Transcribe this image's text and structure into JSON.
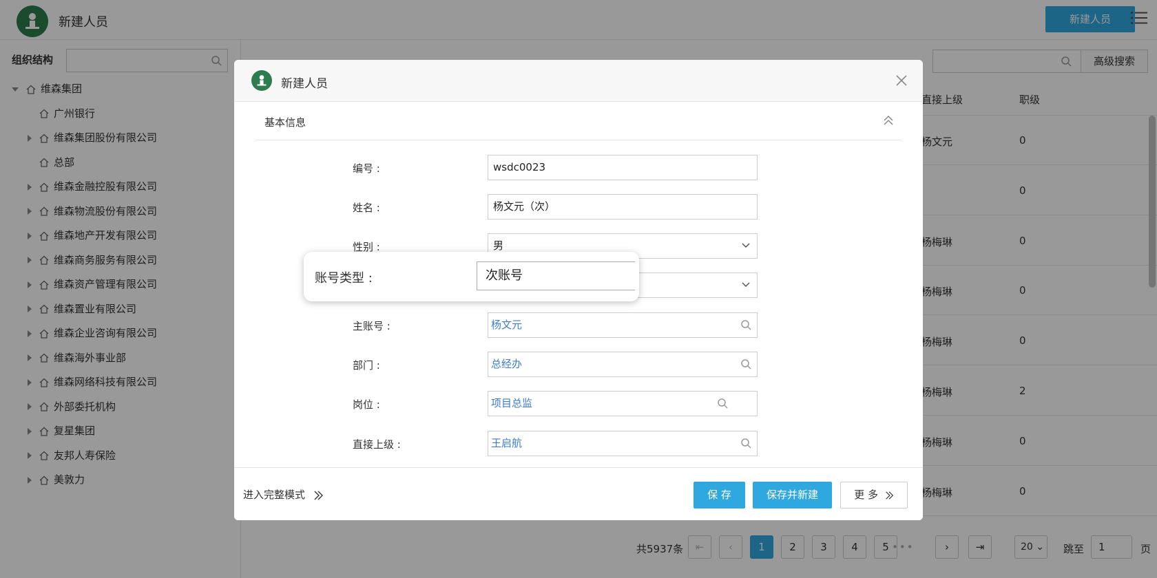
{
  "topbar": {
    "title": "新建人员",
    "new_button": "新建人员"
  },
  "sidebar": {
    "title": "组织结构",
    "tree": [
      {
        "label": "维森集团",
        "expanded": true,
        "level": 0
      },
      {
        "label": "广州银行",
        "expandable": false,
        "level": 1
      },
      {
        "label": "维森集团股份有限公司",
        "expandable": true,
        "level": 1
      },
      {
        "label": "总部",
        "expandable": false,
        "level": 1
      },
      {
        "label": "维森金融控股有限公司",
        "expandable": true,
        "level": 1
      },
      {
        "label": "维森物流股份有限公司",
        "expandable": true,
        "level": 1
      },
      {
        "label": "维森地产开发有限公司",
        "expandable": true,
        "level": 1
      },
      {
        "label": "维森商务服务有限公司",
        "expandable": true,
        "level": 1
      },
      {
        "label": "维森资产管理有限公司",
        "expandable": true,
        "level": 1
      },
      {
        "label": "维森置业有限公司",
        "expandable": true,
        "level": 1
      },
      {
        "label": "维森企业咨询有限公司",
        "expandable": true,
        "level": 1
      },
      {
        "label": "维森海外事业部",
        "expandable": true,
        "level": 1
      },
      {
        "label": "维森网络科技有限公司",
        "expandable": true,
        "level": 1
      },
      {
        "label": "外部委托机构",
        "expandable": true,
        "level": 1
      },
      {
        "label": "复星集团",
        "expandable": true,
        "level": 1
      },
      {
        "label": "友邦人寿保险",
        "expandable": true,
        "level": 1
      },
      {
        "label": "美敦力",
        "expandable": true,
        "level": 1
      }
    ]
  },
  "main": {
    "adv_search_label": "高级搜索",
    "columns": [
      "直接上级",
      "职级"
    ],
    "rows": [
      {
        "superior": "杨文元",
        "rank": "0"
      },
      {
        "superior": "",
        "rank": "0"
      },
      {
        "superior": "杨梅琳",
        "rank": "0"
      },
      {
        "superior": "杨梅琳",
        "rank": "0"
      },
      {
        "superior": "杨梅琳",
        "rank": "0"
      },
      {
        "superior": "杨梅琳",
        "rank": "2"
      },
      {
        "superior": "杨梅琳",
        "rank": "0"
      },
      {
        "superior": "杨梅琳",
        "rank": "0"
      }
    ],
    "pagination": {
      "total": "共5937条",
      "pages": [
        "1",
        "2",
        "3",
        "4",
        "5"
      ],
      "current": "1",
      "dots": "•••",
      "page_size": "20",
      "jump_label": "跳至",
      "jump_value": "1",
      "page_suffix": "页"
    }
  },
  "modal": {
    "title": "新建人员",
    "section": "基本信息",
    "fields": {
      "code": {
        "label": "编号 :",
        "value": "wsdc0023"
      },
      "name": {
        "label": "姓名 :",
        "value": "杨文元（次）"
      },
      "gender": {
        "label": "性别 :",
        "value": "男"
      },
      "main_account": {
        "label": "主账号 :",
        "value": "杨文元"
      },
      "department": {
        "label": "部门 :",
        "value": "总经办"
      },
      "position": {
        "label": "岗位 :",
        "value": "项目总监"
      },
      "superior": {
        "label": "直接上级 :",
        "value": "王启航"
      }
    },
    "footer": {
      "full_mode": "进入完整模式",
      "save": "保 存",
      "save_new": "保存并新建",
      "more": "更 多"
    }
  },
  "popup": {
    "label": "账号类型 :",
    "value": "次账号"
  },
  "colors": {
    "accent": "#2fa8e0",
    "brand_green": "#2e7d4f",
    "link": "#3a7bd5"
  }
}
